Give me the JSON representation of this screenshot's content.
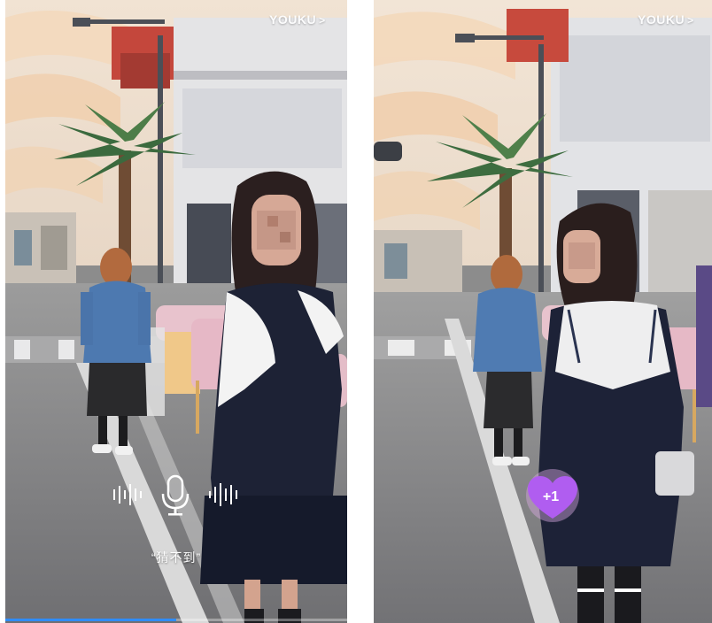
{
  "logo": "YOUKU",
  "logo_arrow": ">",
  "left_panel": {
    "caption": "“猜不到”",
    "progress_percent": 50
  },
  "right_panel": {
    "like_badge": "+1"
  },
  "colors": {
    "accent": "#2f8cff",
    "like": "#b05df0"
  }
}
